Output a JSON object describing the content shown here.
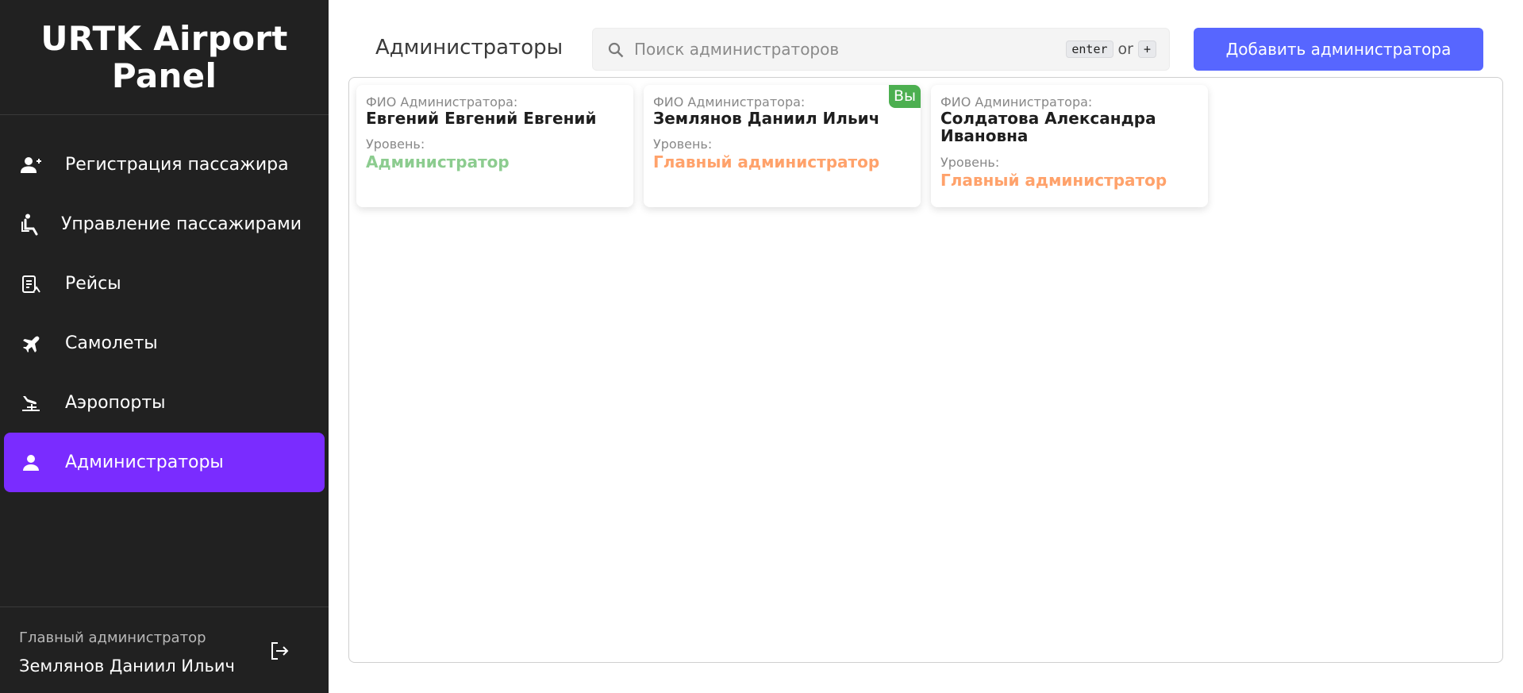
{
  "sidebar": {
    "brand": "URTK Airport Panel",
    "items": [
      {
        "label": "Регистрация пассажира",
        "icon": "person-add-icon"
      },
      {
        "label": "Управление пассажирами",
        "icon": "accessible-seat-icon"
      },
      {
        "label": "Рейсы",
        "icon": "flight-list-icon"
      },
      {
        "label": "Самолеты",
        "icon": "airplane-icon"
      },
      {
        "label": "Аэропорты",
        "icon": "airport-landing-icon"
      },
      {
        "label": "Администраторы",
        "icon": "person-icon",
        "active": true
      }
    ],
    "footer": {
      "role": "Главный администратор",
      "name": "Землянов Даниил Ильич",
      "logout_icon": "logout-icon"
    }
  },
  "header": {
    "title": "Администраторы",
    "search": {
      "placeholder": "Поиск администраторов",
      "value": "",
      "hint_key1": "enter",
      "hint_or": "or",
      "hint_key2": "+"
    },
    "add_button": "Добавить администратора"
  },
  "cards": [
    {
      "fio_label": "ФИО Администратора:",
      "fio": "Евгений Евгений Евгений",
      "level_label": "Уровень:",
      "level": "Администратор",
      "level_color": "#8ccc8f"
    },
    {
      "fio_label": "ФИО Администратора:",
      "fio": "Землянов Даниил Ильич",
      "level_label": "Уровень:",
      "level": "Главный администратор",
      "level_color": "#ffa26b",
      "badge": "Вы"
    },
    {
      "fio_label": "ФИО Администратора:",
      "fio": "Солдатова Александра Ивановна",
      "level_label": "Уровень:",
      "level": "Главный администратор",
      "level_color": "#ffa26b"
    }
  ],
  "colors": {
    "sidebar_bg": "#212121",
    "active_item": "#7a2cff",
    "primary_button": "#5766ff",
    "badge": "#4caf50",
    "level_admin": "#8ccc8f",
    "level_main_admin": "#ffa26b"
  }
}
